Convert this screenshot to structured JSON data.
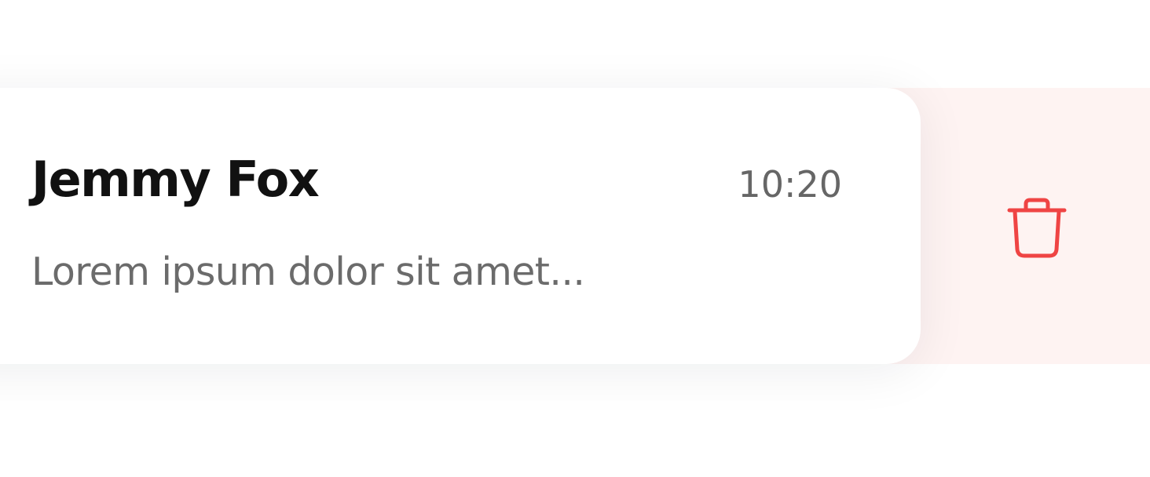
{
  "conversation": {
    "contact_name": "Jemmy Fox",
    "time": "10:20",
    "preview": "Lorem ipsum dolor sit amet..."
  },
  "swipe_action": {
    "icon": "trash-icon",
    "accent_color": "#ef4444",
    "background_color": "#fef3f2"
  }
}
